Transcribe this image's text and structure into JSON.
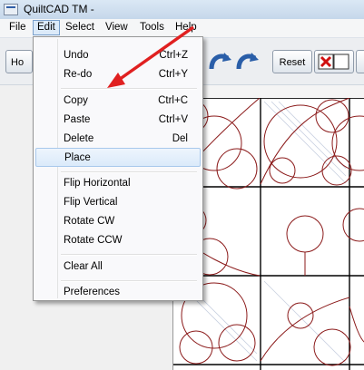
{
  "window": {
    "title": "QuiltCAD TM -"
  },
  "menubar": {
    "items": [
      "File",
      "Edit",
      "Select",
      "View",
      "Tools",
      "Help"
    ]
  },
  "toolbar": {
    "home_label": "Ho",
    "reset_label": "Reset"
  },
  "edit_menu": {
    "items": [
      {
        "label": "Undo",
        "shortcut": "Ctrl+Z"
      },
      {
        "label": "Re-do",
        "shortcut": "Ctrl+Y"
      },
      {
        "label": "Copy",
        "shortcut": "Ctrl+C"
      },
      {
        "label": "Paste",
        "shortcut": "Ctrl+V"
      },
      {
        "label": "Delete",
        "shortcut": "Del"
      },
      {
        "label": "Place",
        "shortcut": ""
      },
      {
        "label": "Flip Horizontal",
        "shortcut": ""
      },
      {
        "label": "Flip Vertical",
        "shortcut": ""
      },
      {
        "label": "Rotate CW",
        "shortcut": ""
      },
      {
        "label": "Rotate CCW",
        "shortcut": ""
      },
      {
        "label": "Clear All",
        "shortcut": ""
      },
      {
        "label": "Preferences",
        "shortcut": ""
      }
    ],
    "highlighted": "Place"
  },
  "colors": {
    "quilt_line": "#8b1a1a",
    "annotation_arrow": "#e02020",
    "menu_hover": "#dbeafa"
  }
}
